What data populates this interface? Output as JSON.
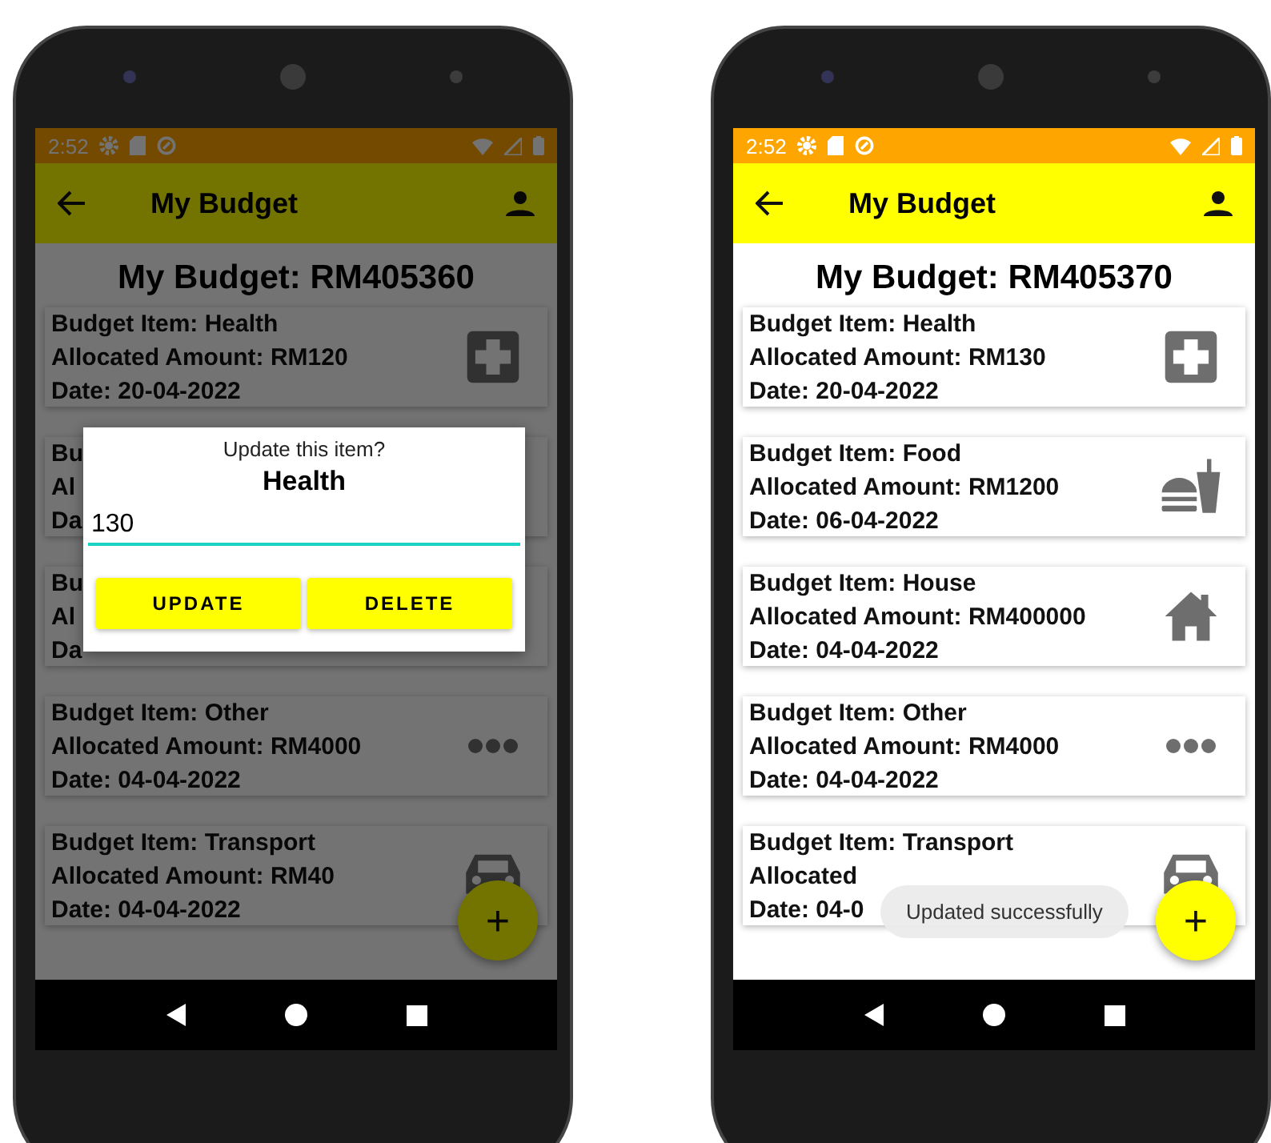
{
  "phones": [
    {
      "dimmed": true,
      "status_bar": {
        "time": "2:52"
      },
      "app_bar": {
        "title": "My Budget"
      },
      "heading": "My Budget: RM405360",
      "cards": [
        {
          "kind": "health",
          "lines": [
            "Budget Item: Health",
            "Allocated Amount: RM120",
            "Date: 20-04-2022"
          ]
        },
        {
          "lines": [
            "Bu",
            "Al",
            "Da"
          ]
        },
        {
          "lines": [
            "Bu",
            "Al",
            "Da"
          ]
        },
        {
          "kind": "other",
          "lines": [
            "Budget Item: Other",
            "Allocated Amount: RM4000",
            "Date: 04-04-2022"
          ]
        },
        {
          "kind": "transport",
          "lines": [
            "Budget Item: Transport",
            "Allocated Amount: RM40",
            "Date: 04-04-2022"
          ]
        }
      ],
      "fab": {
        "label": "+"
      },
      "dialog": {
        "prompt": "Update this item?",
        "title": "Health",
        "value": "130",
        "buttons": [
          "UPDATE",
          "DELETE"
        ]
      }
    },
    {
      "dimmed": false,
      "status_bar": {
        "time": "2:52"
      },
      "app_bar": {
        "title": "My Budget"
      },
      "heading": "My Budget: RM405370",
      "cards": [
        {
          "kind": "health",
          "lines": [
            "Budget Item: Health",
            "Allocated Amount: RM130",
            "Date: 20-04-2022"
          ]
        },
        {
          "kind": "food",
          "lines": [
            "Budget Item: Food",
            "Allocated Amount: RM1200",
            "Date: 06-04-2022"
          ]
        },
        {
          "kind": "house",
          "lines": [
            "Budget Item: House",
            "Allocated Amount: RM400000",
            "Date: 04-04-2022"
          ]
        },
        {
          "kind": "other",
          "lines": [
            "Budget Item: Other",
            "Allocated Amount: RM4000",
            "Date: 04-04-2022"
          ]
        },
        {
          "kind": "transport",
          "lines": [
            "Budget Item: Transport",
            "Allocated",
            "Date: 04-0"
          ]
        }
      ],
      "fab": {
        "label": "+"
      },
      "toast": {
        "text": "Updated successfully"
      }
    }
  ]
}
